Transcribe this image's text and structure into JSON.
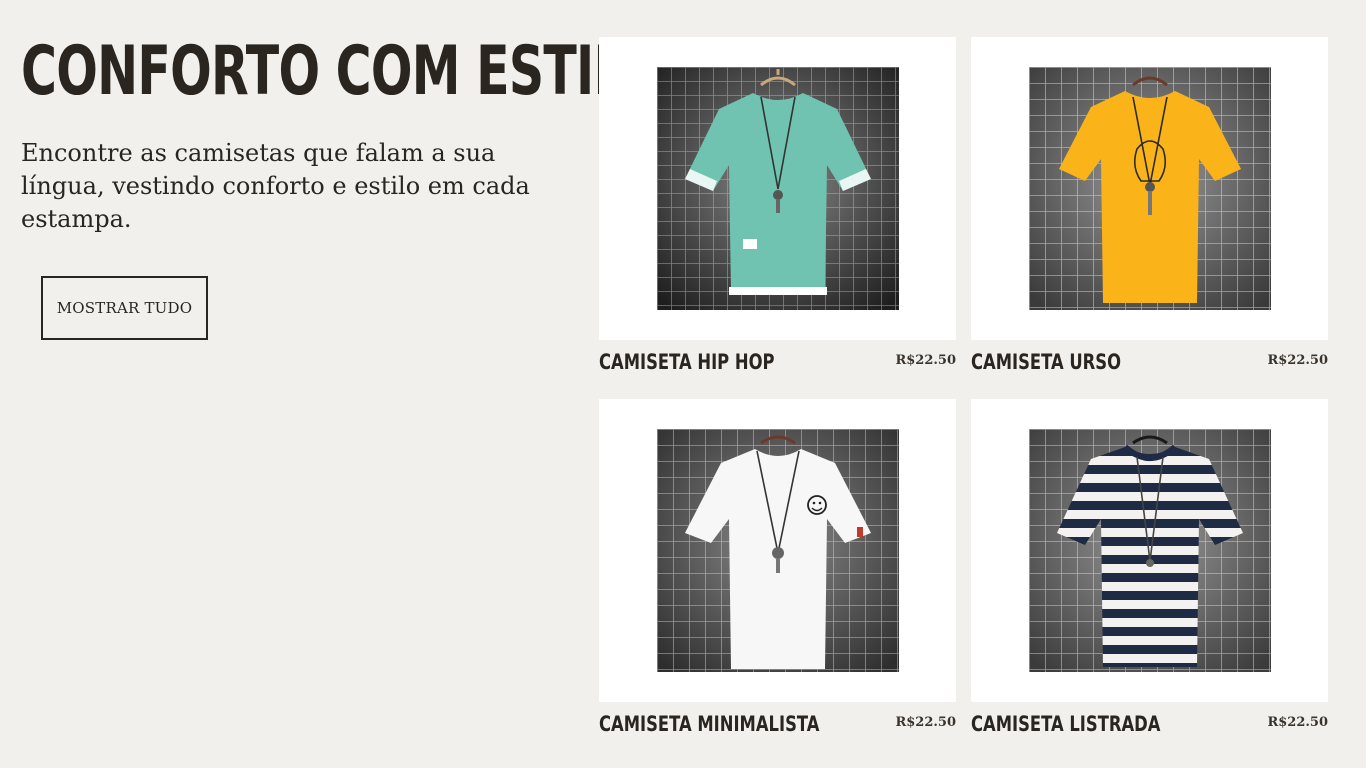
{
  "hero": {
    "title": "CONFORTO COM ESTILO",
    "subtitle": "Encontre as camisetas que falam a sua língua, vestindo conforto e estilo em cada estampa.",
    "button_label": "MOSTRAR TUDO"
  },
  "products": [
    {
      "name": "CAMISETA HIP HOP",
      "price": "R$22.50",
      "shirt_color": "#6fc3b0",
      "icon": "teal-tshirt-photo"
    },
    {
      "name": "CAMISETA URSO",
      "price": "R$22.50",
      "shirt_color": "#fbb31a",
      "icon": "yellow-bear-tshirt-photo"
    },
    {
      "name": "CAMISETA MINIMALISTA",
      "price": "R$22.50",
      "shirt_color": "#f7f7f7",
      "icon": "white-smiley-tshirt-photo"
    },
    {
      "name": "CAMISETA LISTRADA",
      "price": "R$22.50",
      "shirt_color": "#f4f2f0",
      "stripe_color": "#1f2a44",
      "icon": "striped-tshirt-photo"
    }
  ],
  "colors": {
    "background": "#f1f0ed",
    "text": "#2a251f",
    "card": "#ffffff",
    "wall": "#5e5e5e"
  }
}
